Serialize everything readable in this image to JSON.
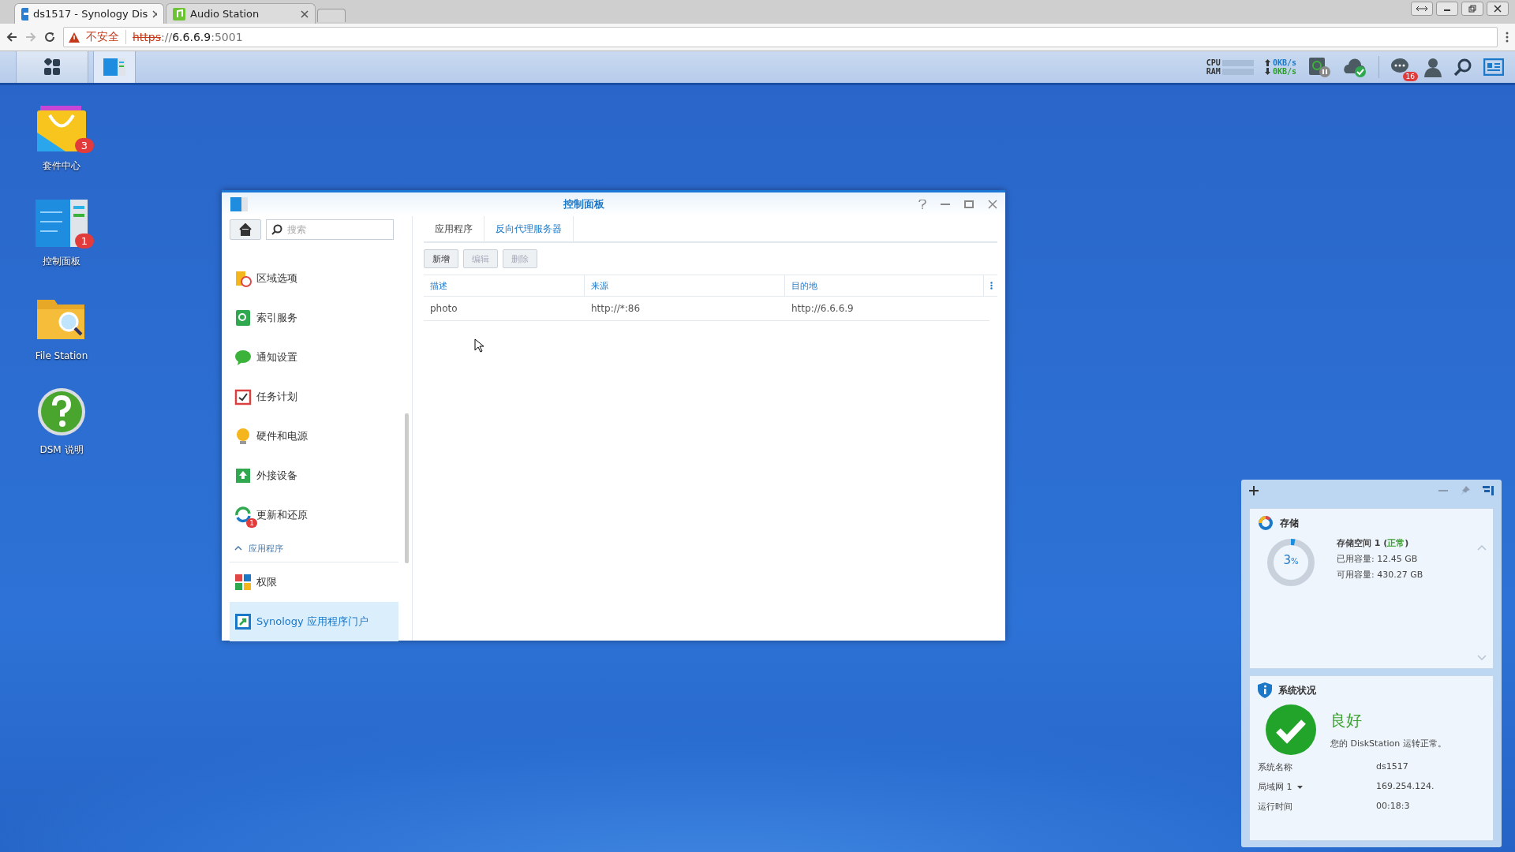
{
  "browser": {
    "tabs": [
      {
        "title": "ds1517 - Synology Dis",
        "selected": true
      },
      {
        "title": "Audio Station",
        "selected": false
      }
    ],
    "address": {
      "warning": "不安全",
      "scheme": "https",
      "separator": "://",
      "host": "6.6.6.9",
      "port": ":5001"
    }
  },
  "taskbar": {
    "cpu_label": "CPU",
    "ram_label": "RAM",
    "upload": "0KB/s",
    "download": "0KB/s",
    "notification_count": "16"
  },
  "desktop_icons": [
    {
      "label": "套件中心",
      "badge": "3"
    },
    {
      "label": "控制面板",
      "badge": "1"
    },
    {
      "label": "File Station"
    },
    {
      "label": "DSM 说明"
    }
  ],
  "window": {
    "title": "控制面板",
    "search": {
      "placeholder": "搜索"
    },
    "sidebar": [
      {
        "kind": "item",
        "label": "区域选项",
        "selected": false
      },
      {
        "kind": "item",
        "label": "索引服务",
        "selected": false
      },
      {
        "kind": "item",
        "label": "通知设置",
        "selected": false
      },
      {
        "kind": "item",
        "label": "任务计划",
        "selected": false
      },
      {
        "kind": "item",
        "label": "硬件和电源",
        "selected": false
      },
      {
        "kind": "item",
        "label": "外接设备",
        "selected": false
      },
      {
        "kind": "item",
        "label": "更新和还原",
        "badge": "1",
        "selected": false
      },
      {
        "kind": "section",
        "label": "应用程序",
        "expanded": true
      },
      {
        "kind": "item",
        "label": "权限",
        "selected": false
      },
      {
        "kind": "item",
        "label": "Synology 应用程序门户",
        "selected": true
      }
    ],
    "tabs": [
      {
        "label": "应用程序",
        "selected": false
      },
      {
        "label": "反向代理服务器",
        "selected": true
      }
    ],
    "buttons": [
      {
        "label": "新增",
        "disabled": false
      },
      {
        "label": "编辑",
        "disabled": true
      },
      {
        "label": "删除",
        "disabled": true
      }
    ],
    "table": {
      "columns": [
        "描述",
        "来源",
        "目的地"
      ],
      "rows": [
        [
          "photo",
          "http://*:86",
          "http://6.6.6.9"
        ]
      ]
    }
  },
  "widgets": {
    "storage": {
      "title": "存储",
      "percent": "3",
      "unit": "%",
      "level": 0.03,
      "volume": "存储空间 1 (**正常**)",
      "used": "已用容量: 12.45 GB",
      "free": "可用容量: 430.27 GB"
    },
    "system": {
      "title": "系统状况",
      "status": "良好",
      "message": "您的 DiskStation 运转正常。",
      "rows": [
        {
          "label": "系统名称",
          "value": "ds1517",
          "dropdown": false
        },
        {
          "label": "局域网 1",
          "value": "169.254.124.",
          "dropdown": true
        },
        {
          "label": "运行时间",
          "value": "00:18:3",
          "dropdown": false
        }
      ]
    }
  }
}
